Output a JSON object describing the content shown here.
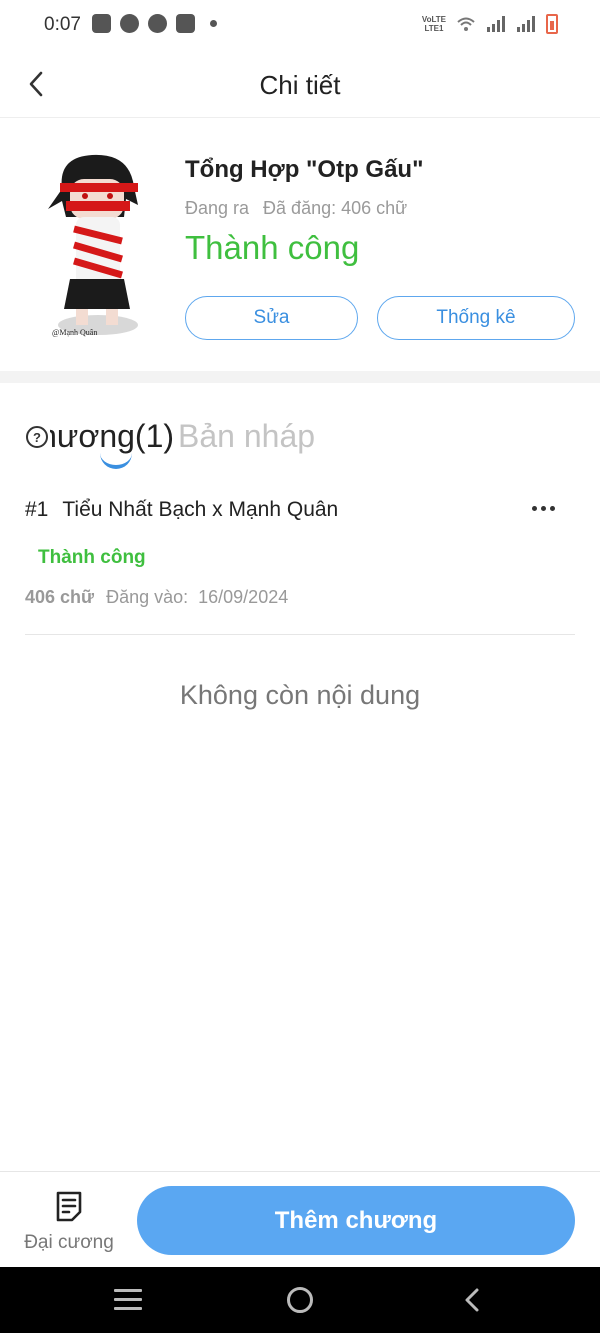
{
  "status_bar": {
    "time": "0:07",
    "left_icons": [
      "zalo-icon",
      "messenger-icon",
      "app-icon",
      "shop-icon",
      "dot-icon"
    ],
    "volte_line1": "VoLTE",
    "volte_line2": "LTE1",
    "battery_color": "#e8664a"
  },
  "header": {
    "back_icon": "chevron-left-icon",
    "title": "Chi tiết"
  },
  "story": {
    "title": "Tổng Hợp \"Otp Gấu\"",
    "state": "Đang ra",
    "words_published": "Đã đăng: 406 chữ",
    "status": "Thành công",
    "edit_label": "Sửa",
    "stats_label": "Thống kê",
    "cover_watermark": "@Mạnh Quân"
  },
  "tabs": {
    "help_icon": "question-circle-icon",
    "items": [
      {
        "label": "Chương(1)",
        "active": true
      },
      {
        "label": "Bản nháp",
        "active": false
      }
    ]
  },
  "chapters": [
    {
      "number": "#1",
      "title": "Tiểu Nhất Bạch x Mạnh Quân",
      "status": "Thành công",
      "words": "406 chữ",
      "published_label": "Đăng vào:",
      "published_date": "16/09/2024"
    }
  ],
  "empty_message": "Không còn nội dung",
  "bottom_bar": {
    "outline_label": "Đại cương",
    "add_chapter_label": "Thêm chương"
  },
  "colors": {
    "accent": "#5aa7f2",
    "success": "#3fbf3f",
    "outline": "#5ea7ee"
  }
}
